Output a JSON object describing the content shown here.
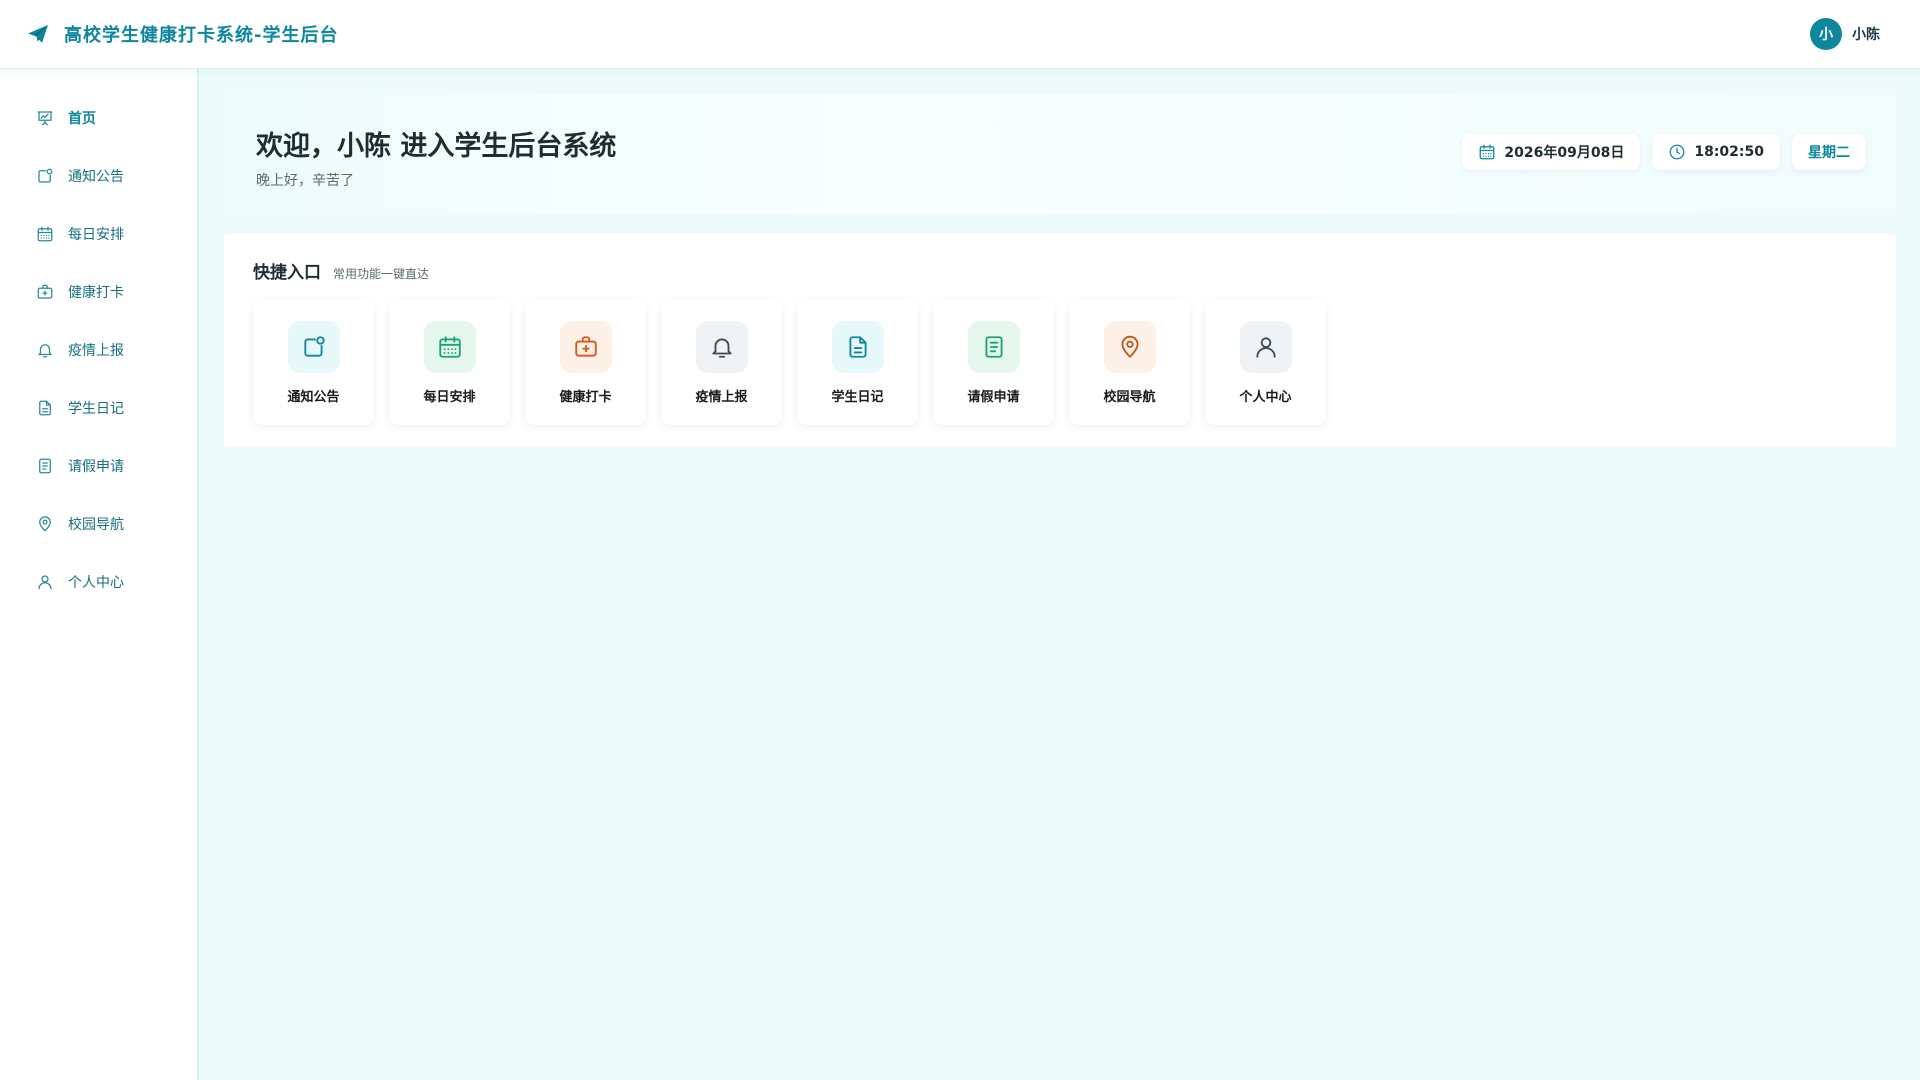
{
  "header": {
    "title": "高校学生健康打卡系统-学生后台",
    "user": {
      "avatar_text": "小",
      "name": "小陈"
    }
  },
  "sidebar": {
    "items": [
      {
        "label": "首页",
        "icon": "presentation-chart-icon",
        "active": true
      },
      {
        "label": "通知公告",
        "icon": "notification-icon"
      },
      {
        "label": "每日安排",
        "icon": "calendar-icon"
      },
      {
        "label": "健康打卡",
        "icon": "medical-bag-icon"
      },
      {
        "label": "疫情上报",
        "icon": "bell-icon"
      },
      {
        "label": "学生日记",
        "icon": "document-icon"
      },
      {
        "label": "请假申请",
        "icon": "form-icon"
      },
      {
        "label": "校园导航",
        "icon": "map-pin-icon"
      },
      {
        "label": "个人中心",
        "icon": "user-icon"
      }
    ]
  },
  "welcome": {
    "title": "欢迎，小陈 进入学生后台系统",
    "subtitle": "晚上好，辛苦了",
    "date": "2026年09月08日",
    "time": "18:02:50",
    "weekday": "星期二"
  },
  "quick": {
    "title": "快捷入口",
    "subtitle": "常用功能一键直达",
    "tiles": [
      {
        "label": "通知公告",
        "icon": "notification-icon",
        "color": "#0e869e",
        "bg": "#e7f8fa"
      },
      {
        "label": "每日安排",
        "icon": "calendar-icon",
        "color": "#17a36b",
        "bg": "#e6f7ee"
      },
      {
        "label": "健康打卡",
        "icon": "medical-bag-icon",
        "color": "#d8561a",
        "bg": "#fdf0e6"
      },
      {
        "label": "疫情上报",
        "icon": "bell-icon",
        "color": "#3b4a55",
        "bg": "#f0f3f5"
      },
      {
        "label": "学生日记",
        "icon": "document-icon",
        "color": "#0e869e",
        "bg": "#e7f8fa"
      },
      {
        "label": "请假申请",
        "icon": "form-icon",
        "color": "#17a36b",
        "bg": "#e6f7ee"
      },
      {
        "label": "校园导航",
        "icon": "map-pin-icon",
        "color": "#c2541c",
        "bg": "#fdf0e6"
      },
      {
        "label": "个人中心",
        "icon": "user-icon",
        "color": "#3b4a55",
        "bg": "#f0f3f5"
      }
    ]
  },
  "colors": {
    "accent": "#0e869e",
    "page_bg": "#edfbfb"
  }
}
